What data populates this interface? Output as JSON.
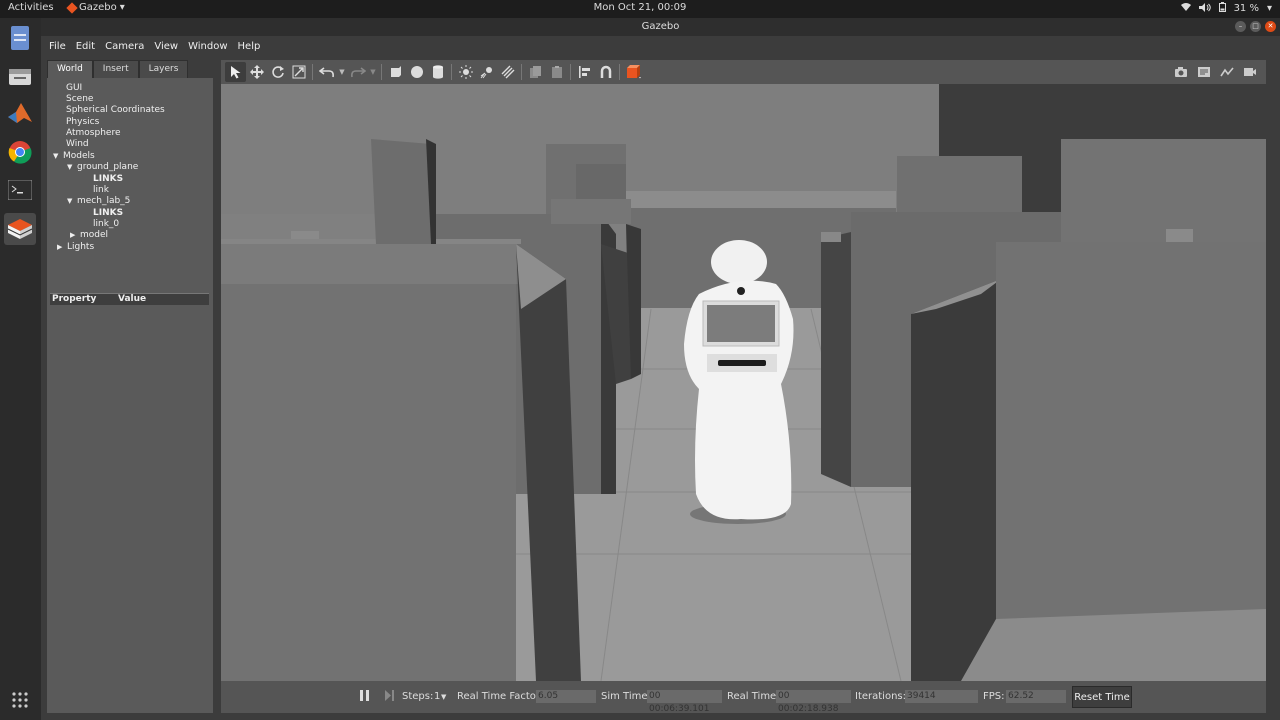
{
  "topbar": {
    "activities": "Activities",
    "app_name": "Gazebo",
    "clock": "Mon Oct 21, 00:09",
    "battery": "31 %"
  },
  "dock": {
    "items": [
      "files-icon",
      "software-icon",
      "matlab-icon",
      "chrome-icon",
      "terminal-icon",
      "gazebo-icon"
    ],
    "apps_grid_icon": "show-applications-icon"
  },
  "window": {
    "title": "Gazebo"
  },
  "menubar": {
    "items": [
      "File",
      "Edit",
      "Camera",
      "View",
      "Window",
      "Help"
    ]
  },
  "left_panel": {
    "tabs": [
      "World",
      "Insert",
      "Layers"
    ],
    "tree": [
      {
        "label": "GUI"
      },
      {
        "label": "Scene"
      },
      {
        "label": "Spherical Coordinates"
      },
      {
        "label": "Physics"
      },
      {
        "label": "Atmosphere"
      },
      {
        "label": "Wind"
      },
      {
        "label": "Models"
      },
      {
        "label": "ground_plane"
      },
      {
        "label": "LINKS"
      },
      {
        "label": "link"
      },
      {
        "label": "mech_lab_5"
      },
      {
        "label": "LINKS"
      },
      {
        "label": "link_0"
      },
      {
        "label": "model"
      },
      {
        "label": "Lights"
      }
    ],
    "property_header": "Property",
    "value_header": "Value"
  },
  "toolbar": {
    "tools": [
      "select-arrow-icon",
      "translate-icon",
      "rotate-icon",
      "scale-icon",
      "undo-icon",
      "redo-icon",
      "box-icon",
      "sphere-icon",
      "cylinder-icon",
      "point-light-icon",
      "spot-light-icon",
      "directional-light-icon",
      "copy-icon",
      "paste-icon",
      "align-icon",
      "snap-icon",
      "change-view-icon"
    ],
    "right_tools": [
      "screenshot-icon",
      "log-icon",
      "plot-icon",
      "video-record-icon"
    ]
  },
  "bottom_bar": {
    "steps_label": "Steps:",
    "steps_value": "1",
    "rtf_label": "Real Time Factor:",
    "rtf_value": "6.05",
    "sim_time_label": "Sim Time:",
    "sim_time_value": "00 00:06:39.101",
    "real_time_label": "Real Time:",
    "real_time_value": "00 00:02:18.938",
    "iterations_label": "Iterations:",
    "iterations_value": "39414",
    "fps_label": "FPS:",
    "fps_value": "62.52",
    "reset_label": "Reset Time"
  },
  "colors": {
    "accent_orange": "#e95420",
    "viewport_floor": "#9a9a9a",
    "wall": "#6e6e6e"
  }
}
